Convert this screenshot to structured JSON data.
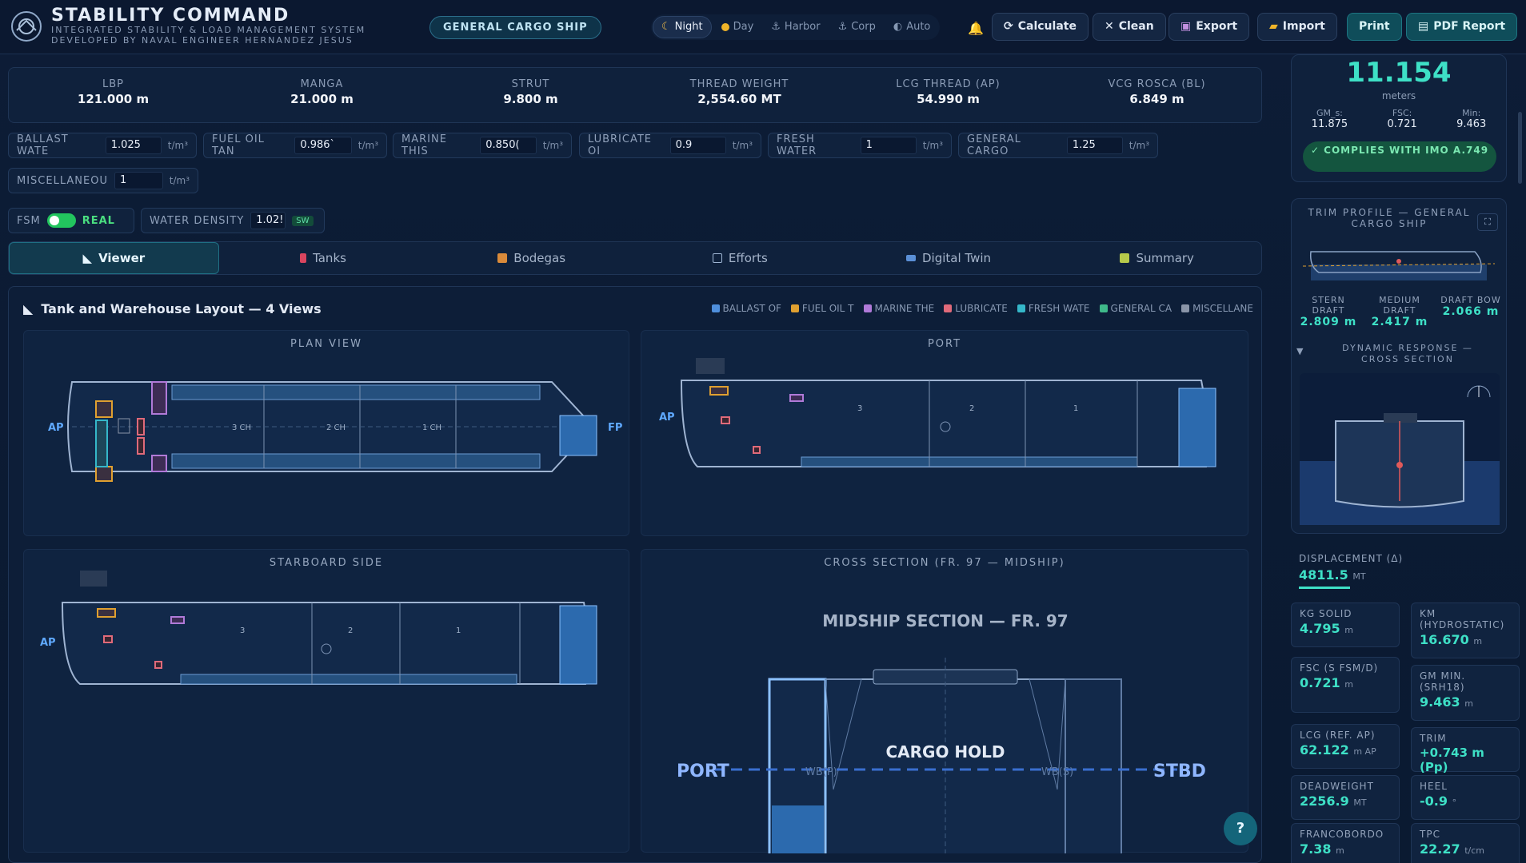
{
  "app": {
    "title": "STABILITY COMMAND",
    "subtitle_1": "INTEGRATED STABILITY & LOAD MANAGEMENT SYSTEM",
    "subtitle_2": "DEVELOPED BY NAVAL ENGINEER HERNANDEZ JESUS",
    "ship_type": "GENERAL CARGO SHIP"
  },
  "modes": [
    {
      "label": "Night",
      "icon": "moon-icon",
      "active": true
    },
    {
      "label": "Day",
      "icon": "sun-icon"
    },
    {
      "label": "Harbor",
      "icon": "anchor-icon"
    },
    {
      "label": "Corp",
      "icon": "anchor-icon"
    },
    {
      "label": "Auto",
      "icon": "half-circle-icon"
    }
  ],
  "toolbar": {
    "calculate": "Calculate",
    "clean": "Clean",
    "export": "Export",
    "import": "Import",
    "print": "Print",
    "pdf": "PDF Report"
  },
  "specs": [
    {
      "k": "LBP",
      "v": "121.000 m"
    },
    {
      "k": "MANGA",
      "v": "21.000 m"
    },
    {
      "k": "STRUT",
      "v": "9.800 m"
    },
    {
      "k": "THREAD WEIGHT",
      "v": "2,554.60 MT"
    },
    {
      "k": "LCG THREAD (AP)",
      "v": "54.990 m"
    },
    {
      "k": "VCG ROSCA (BL)",
      "v": "6.849 m"
    }
  ],
  "densities": [
    {
      "k": "BALLAST WATE",
      "v": "1.025",
      "u": "t/m³"
    },
    {
      "k": "FUEL OIL TAN",
      "v": "0.986`",
      "u": "t/m³"
    },
    {
      "k": "MARINE THIS",
      "v": "0.850(",
      "u": "t/m³"
    },
    {
      "k": "LUBRICATE OI",
      "v": "0.9",
      "u": "t/m³"
    },
    {
      "k": "FRESH WATER",
      "v": "1",
      "u": "t/m³"
    },
    {
      "k": "GENERAL CARGO",
      "v": "1.25",
      "u": "t/m³"
    },
    {
      "k": "MISCELLANEOU",
      "v": "1",
      "u": "t/m³"
    }
  ],
  "fsm": {
    "label": "FSM",
    "state": "REAL",
    "water_density_label": "WATER DENSITY",
    "water_density": "1.02!",
    "sw": "SW"
  },
  "tabs": [
    {
      "label": "Viewer",
      "active": true
    },
    {
      "label": "Tanks"
    },
    {
      "label": "Bodegas"
    },
    {
      "label": "Efforts"
    },
    {
      "label": "Digital Twin"
    },
    {
      "label": "Summary"
    }
  ],
  "layout": {
    "title": "Tank and Warehouse Layout — 4 Views",
    "legend": [
      {
        "label": "BALLAST OF",
        "color": "#4f8fdc"
      },
      {
        "label": "FUEL OIL T",
        "color": "#e0a030"
      },
      {
        "label": "MARINE THE",
        "color": "#b07ad8"
      },
      {
        "label": "LUBRICATE",
        "color": "#e06a7a"
      },
      {
        "label": "FRESH WATE",
        "color": "#35b7c9"
      },
      {
        "label": "GENERAL CA",
        "color": "#3fb98a"
      },
      {
        "label": "MISCELLANE",
        "color": "#8a95a8"
      }
    ]
  },
  "views": {
    "plan": "PLAN VIEW",
    "port": "PORT",
    "starboard": "STARBOARD SIDE",
    "cross": "CROSS SECTION (FR. 97 — MIDSHIP)",
    "ap": "AP",
    "fp": "FP",
    "holds": [
      "3 CH",
      "2 CH",
      "1 CH"
    ],
    "side_holds": [
      "3",
      "2",
      "1"
    ],
    "midship_title": "MIDSHIP SECTION — FR. 97",
    "cargo_hold": "CARGO HOLD",
    "stbd": "STBD",
    "wb_p": "WB(P)",
    "wb_s": "WB(S)"
  },
  "gm": {
    "value": "11.154",
    "unit": "meters",
    "gms_k": "GM_s:",
    "gms_v": "11.875",
    "fsc_k": "FSC:",
    "fsc_v": "0.721",
    "min_k": "Min:",
    "min_v": "9.463",
    "imo": "✓ COMPLIES WITH IMO A.749"
  },
  "trim": {
    "title": "TRIM PROFILE — GENERAL CARGO SHIP",
    "stern_k": "STERN DRAFT",
    "stern_v": "2.809 m",
    "medium_k": "MEDIUM DRAFT",
    "medium_v": "2.417 m",
    "bow_k": "DRAFT BOW",
    "bow_v": "2.066 m",
    "dyn_title": "DYNAMIC RESPONSE — CROSS SECTION"
  },
  "displacement": {
    "k": "DISPLACEMENT (Δ)",
    "v": "4811.5",
    "u": "MT"
  },
  "metrics": [
    {
      "k": "KG SOLID",
      "v": "4.795",
      "u": "m"
    },
    {
      "k": "KM (HYDROSTATIC)",
      "v": "16.670",
      "u": "m"
    },
    {
      "k": "FSC (S FSM/D)",
      "v": "0.721",
      "u": "m"
    },
    {
      "k": "GM MIN. (SRH18)",
      "v": "9.463",
      "u": "m"
    },
    {
      "k": "LCG (REF. AP)",
      "v": "62.122",
      "u": "m AP"
    },
    {
      "k": "TRIM",
      "v": "+0.743 m (Pp)",
      "u": ""
    },
    {
      "k": "DEADWEIGHT",
      "v": "2256.9",
      "u": "MT"
    },
    {
      "k": "HEEL",
      "v": "-0.9",
      "u": "°"
    },
    {
      "k": "FRANCOBORDO",
      "v": "7.38",
      "u": "m"
    },
    {
      "k": "TPC",
      "v": "22.27",
      "u": "t/cm"
    }
  ],
  "help": "?"
}
